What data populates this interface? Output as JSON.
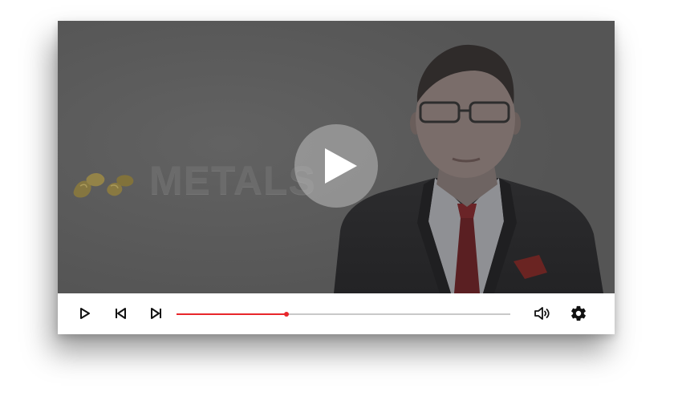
{
  "video": {
    "overlay_text": "METALS",
    "state": "paused",
    "big_play_icon": "play-circle-icon"
  },
  "controls": {
    "play_icon": "play-icon",
    "previous_icon": "skip-previous-icon",
    "next_icon": "skip-next-icon",
    "volume_icon": "volume-icon",
    "settings_icon": "gear-icon",
    "progress_fraction": 0.33,
    "accent_color": "#e8262b",
    "track_color": "#c9c9c9"
  }
}
